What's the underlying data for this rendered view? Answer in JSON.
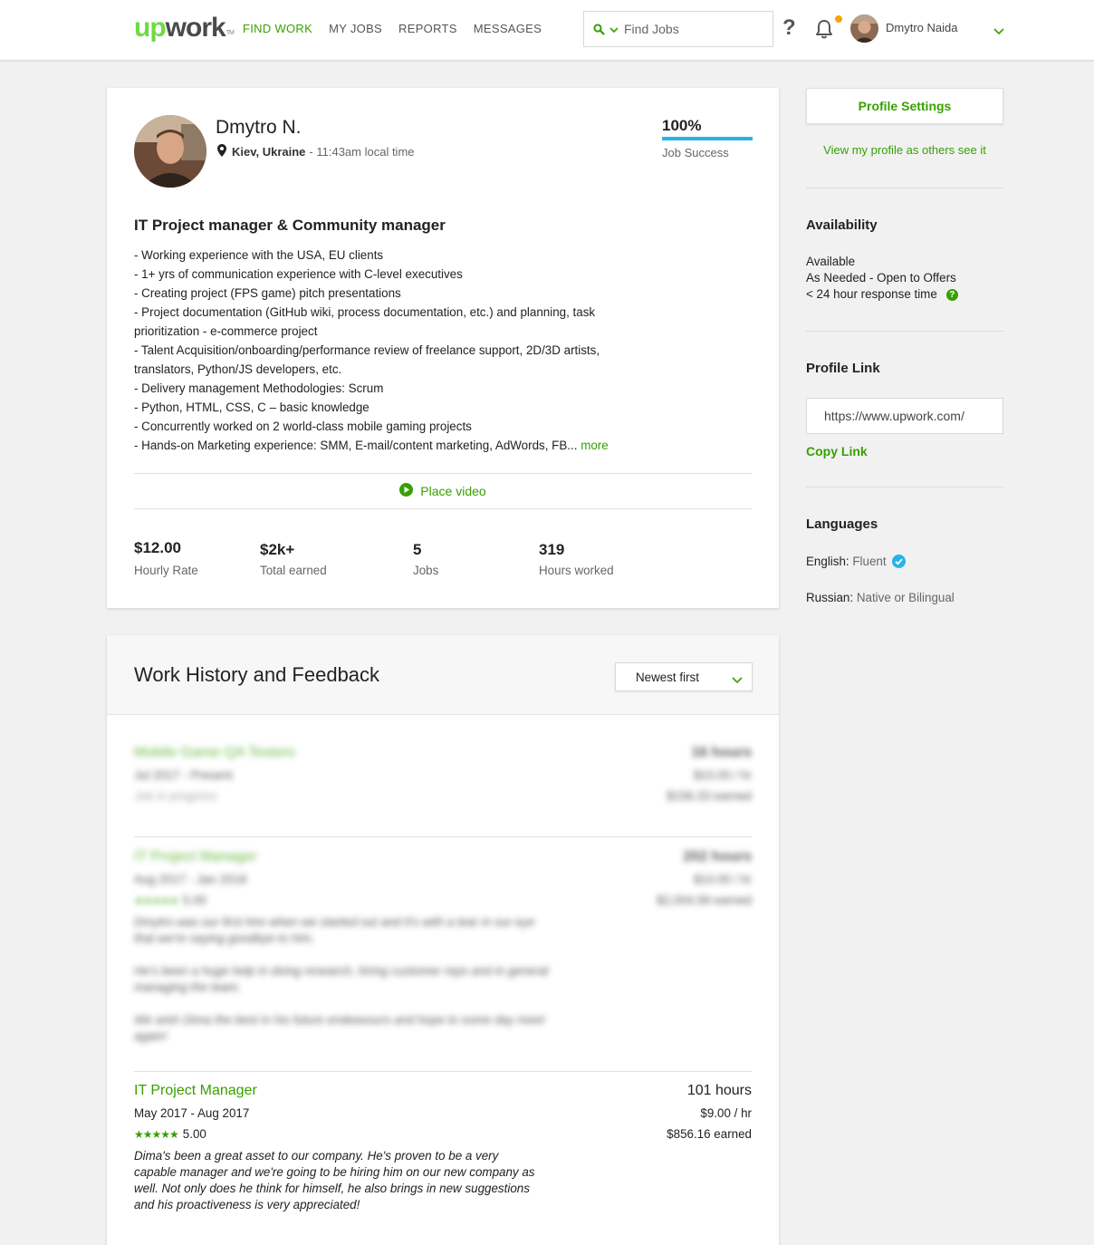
{
  "header": {
    "logo": {
      "up": "up",
      "work": "work",
      "tm": "TM"
    },
    "nav": [
      "FIND WORK",
      "MY JOBS",
      "REPORTS",
      "MESSAGES"
    ],
    "search_placeholder": "Find Jobs",
    "help": "?",
    "user_name": "Dmytro Naida"
  },
  "profile": {
    "name": "Dmytro N.",
    "location": "Kiev, Ukraine",
    "local_time": "- 11:43am local time",
    "job_success_pct": "100%",
    "job_success_value": 100,
    "job_success_label": "Job Success",
    "title": "IT Project manager & Community manager",
    "description_lines": [
      "- Working experience with the USA, EU clients",
      "- 1+ yrs of communication experience with C-level executives",
      "- Creating project (FPS game) pitch presentations",
      "- Project documentation (GitHub wiki, process documentation, etc.) and planning, task",
      "prioritization - e-commerce project",
      "- Talent Acquisition/onboarding/performance review of freelance support, 2D/3D artists,",
      "translators, Python/JS developers, etc.",
      "- Delivery management Methodologies: Scrum",
      "- Python, HTML, CSS, C – basic knowledge",
      "- Concurrently worked on 2 world-class mobile gaming projects"
    ],
    "description_last": "- Hands-on Marketing experience: SMM, E-mail/content marketing, AdWords, FB...",
    "more_label": "more",
    "video_label": "Place video",
    "stats": [
      {
        "value": "$12.00",
        "label": "Hourly Rate"
      },
      {
        "value": "$2k+",
        "label": "Total earned"
      },
      {
        "value": "5",
        "label": "Jobs"
      },
      {
        "value": "319",
        "label": "Hours worked"
      }
    ]
  },
  "sidebar": {
    "settings_button": "Profile Settings",
    "view_link": "View my profile as others see it",
    "availability_heading": "Availability",
    "availability_status": "Available",
    "availability_hours": "As Needed - Open to Offers",
    "response_time": "< 24 hour response time",
    "help_badge": "?",
    "profile_link_heading": "Profile Link",
    "profile_link_value": "https://www.upwork.com/",
    "copy_link": "Copy Link",
    "languages_heading": "Languages",
    "languages": [
      {
        "name": "English:",
        "level": "Fluent",
        "verified": true
      },
      {
        "name": "Russian:",
        "level": "Native or Bilingual",
        "verified": false
      }
    ]
  },
  "work_history": {
    "title": "Work History and Feedback",
    "sort_label": "Newest first",
    "jobs": [
      {
        "title": "Mobile Game QA Testers",
        "dates": "Jul 2017 - Present",
        "status": "Job in progress",
        "hours": "16 hours",
        "rate": "$10.00 / hr",
        "earned": "$156.33 earned",
        "blurred": true
      },
      {
        "title": "IT Project Manager",
        "dates": "Aug 2017 - Jan 2018",
        "stars": "★★★★★",
        "rating": "5.00",
        "hours": "202 hours",
        "rate": "$10.00 / hr",
        "earned": "$2,004.99 earned",
        "feedback": [
          "Dmytro was our first hire when we started out and it's with a tear in our eye that we're saying goodbye to him.",
          "He's been a huge help in doing research, hiring customer reps and in general managing the team.",
          "We wish Dima the best in his future endeavours and hope to some day meet again!"
        ],
        "blurred": true
      },
      {
        "title": "IT Project Manager",
        "dates": "May 2017 - Aug 2017",
        "stars": "★★★★★",
        "rating": "5.00",
        "hours": "101 hours",
        "rate": "$9.00 / hr",
        "earned": "$856.16 earned",
        "feedback": [
          "Dima's been a great asset to our company. He's proven to be a very capable manager and we're going to be hiring him on our new company as well. Not only does he think for himself, he also brings in new suggestions and his proactiveness is very appreciated!"
        ],
        "blurred": false
      }
    ]
  },
  "colors": {
    "brand_green": "#37a000",
    "logo_green": "#6fda44",
    "success_bar": "#29b2e6",
    "notification_dot": "#f0a800",
    "verified_blue": "#29b2e6"
  },
  "icons": [
    "search-icon",
    "chevron-down-icon",
    "help-icon",
    "bell-icon",
    "location-pin-icon",
    "play-icon",
    "verified-icon"
  ]
}
